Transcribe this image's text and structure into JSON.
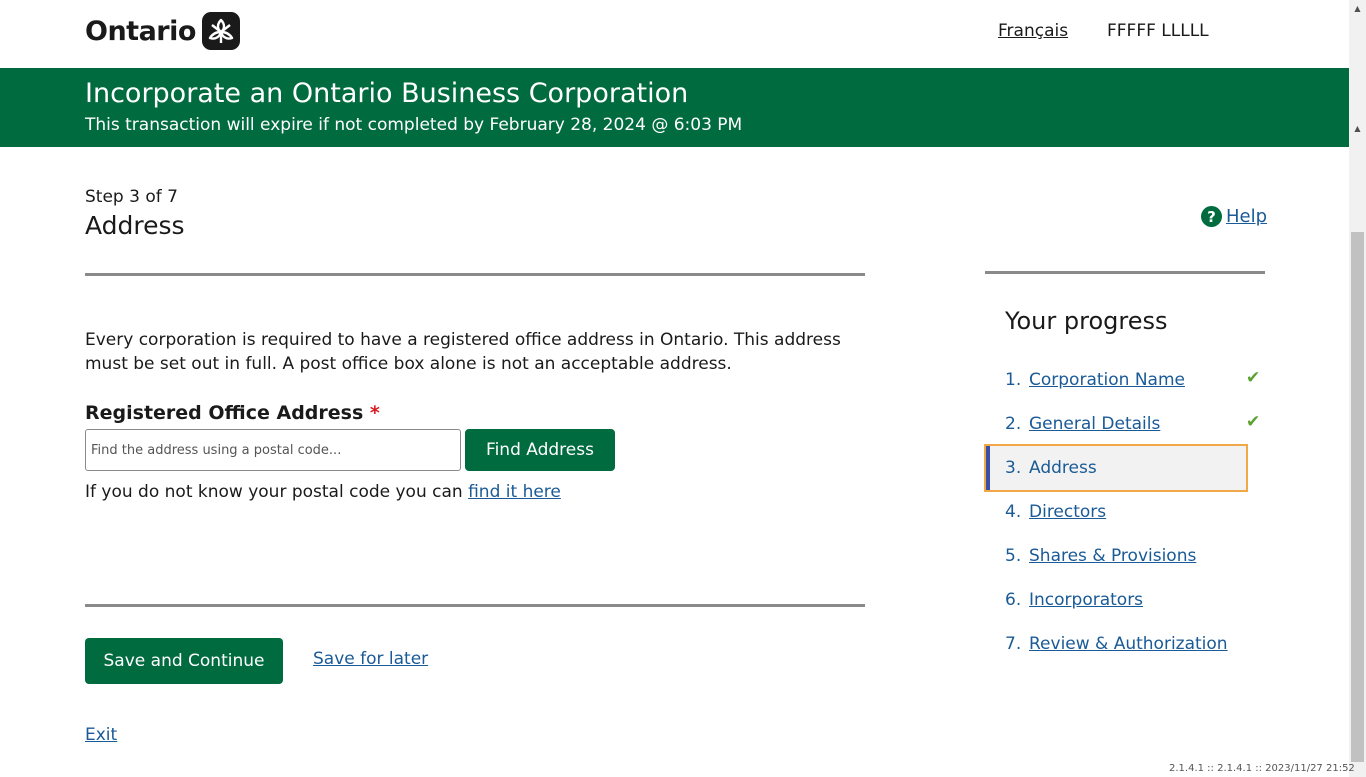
{
  "header": {
    "logo_text": "Ontario",
    "language_link": "Français",
    "user_name": "FFFFF LLLLL"
  },
  "banner": {
    "title": "Incorporate an Ontario Business Corporation",
    "subtitle": "This transaction will expire if not completed by February 28, 2024 @ 6:03 PM"
  },
  "page": {
    "step": "Step 3 of 7",
    "heading": "Address",
    "help_label": "Help",
    "help_icon": "question-circle-icon",
    "intro": "Every corporation is required to have a registered office address in Ontario. This address must be set out in full. A post office box alone is not an acceptable address."
  },
  "address_form": {
    "label": "Registered Office Address",
    "required_marker": "*",
    "search_placeholder": "Find the address using a postal code...",
    "search_value": "",
    "find_button": "Find Address",
    "postal_hint": "If you do not know your postal code you can",
    "postal_link": "find it here"
  },
  "actions": {
    "save_continue": "Save and Continue",
    "save_later": "Save for later",
    "exit": "Exit"
  },
  "progress": {
    "title": "Your progress",
    "items": [
      {
        "num": "1.",
        "label": "Corporation Name",
        "status": "complete"
      },
      {
        "num": "2.",
        "label": "General Details",
        "status": "complete"
      },
      {
        "num": "3.",
        "label": "Address",
        "status": "current"
      },
      {
        "num": "4.",
        "label": "Directors",
        "status": "pending"
      },
      {
        "num": "5.",
        "label": "Shares & Provisions",
        "status": "pending"
      },
      {
        "num": "6.",
        "label": "Incorporators",
        "status": "pending"
      },
      {
        "num": "7.",
        "label": "Review & Authorization",
        "status": "pending"
      }
    ]
  },
  "footer": {
    "version": "2.1.4.1 :: 2.1.4.1 :: 2023/11/27 21:52"
  },
  "colors": {
    "brand_green": "#006b3f",
    "link_blue": "#1a5a96",
    "check_green": "#5da131",
    "required_red": "#d81a21",
    "focus_orange": "#f3a847"
  }
}
